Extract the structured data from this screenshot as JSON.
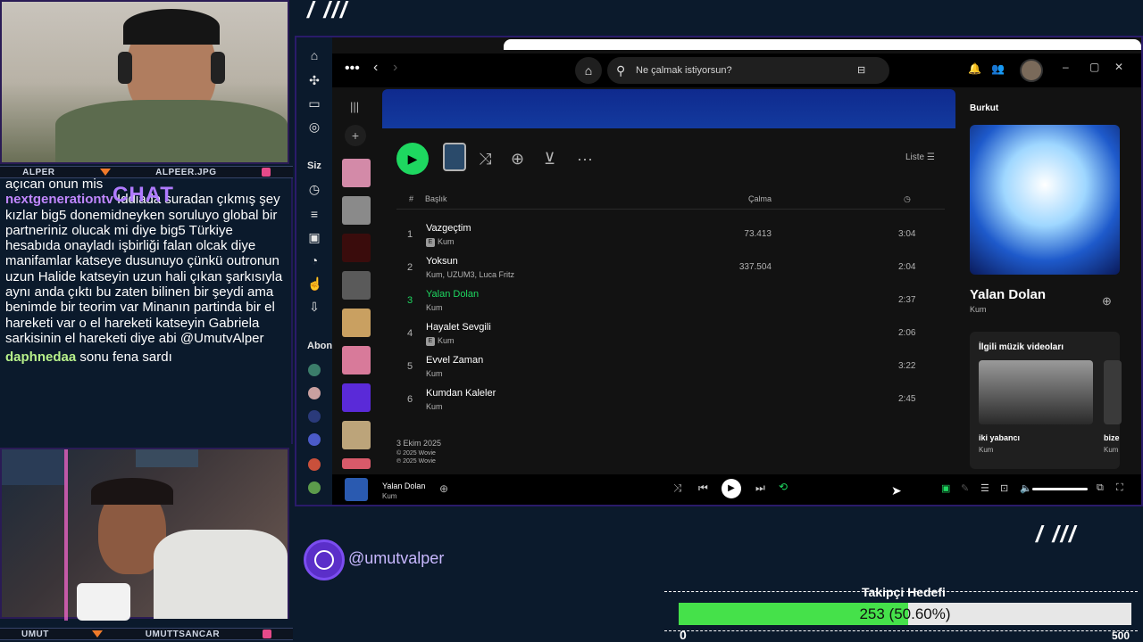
{
  "webcam_top": {
    "left_name": "ALPER",
    "right_name": "ALPEER.JPG"
  },
  "webcam_bottom": {
    "left_name": "UMUT",
    "right_name": "UMUTTSANCAR"
  },
  "chat": {
    "label": "CHAT",
    "partial_line": "açıcan onun mis",
    "messages": [
      {
        "user": "nextgenerationtv",
        "text": "Iddiada suradan çıkmış şey kızlar big5 donemidneyken soruluyo global bir partneriniz olucak mi diye big5 Türkiye hesabıda onayladı işbirliği falan olcak diye manifamlar katseye dusunuyo çünkü outronun uzun Halide katseyin uzun hali çıkan şarkısıyla aynı anda çıktı bu zaten bilinen bir şeydi ama benimde bir teorim var Minanın partinda bir el hareketi var o el hareketi katseyin Gabriela sarkisinin el hareketi diye abi @UmutvAlper"
      },
      {
        "user": "daphnedaa",
        "text": "sonu fena sardı"
      }
    ]
  },
  "spotify": {
    "search_placeholder": "Ne çalmak istiyorsun?",
    "sidebar_you": "Siz",
    "sidebar_subs": "Abon",
    "view_label": "Liste",
    "columns": {
      "hash": "#",
      "title": "Başlık",
      "plays": "Çalma"
    },
    "tracks": [
      {
        "num": "1",
        "title": "Vazgeçtim",
        "artist": "Kum",
        "explicit": "E",
        "plays": "73.413",
        "duration": "3:04",
        "active": false
      },
      {
        "num": "2",
        "title": "Yoksun",
        "artist": "Kum, UZUM3, Luca Fritz",
        "explicit": "",
        "plays": "337.504",
        "duration": "2:04",
        "active": false
      },
      {
        "num": "3",
        "title": "Yalan Dolan",
        "artist": "Kum",
        "explicit": "",
        "plays": "",
        "duration": "2:37",
        "active": true
      },
      {
        "num": "4",
        "title": "Hayalet Sevgili",
        "artist": "Kum",
        "explicit": "E",
        "plays": "",
        "duration": "2:06",
        "active": false
      },
      {
        "num": "5",
        "title": "Evvel Zaman",
        "artist": "Kum",
        "explicit": "",
        "plays": "",
        "duration": "3:22",
        "active": false
      },
      {
        "num": "6",
        "title": "Kumdan Kaleler",
        "artist": "Kum",
        "explicit": "",
        "plays": "",
        "duration": "2:45",
        "active": false
      }
    ],
    "release_date": "3 Ekim 2025",
    "copyright1": "© 2025 Wovie",
    "copyright2": "℗ 2025 Wovie",
    "right_panel": {
      "header": "Burkut",
      "song_title": "Yalan Dolan",
      "song_artist": "Kum",
      "videos_header": "İlgili müzik videoları",
      "video_title": "iki yabancı",
      "video_artist": "Kum",
      "video2_title": "bize",
      "video2_artist": "Kum"
    },
    "now_playing": {
      "title": "Yalan Dolan",
      "artist": "Kum"
    },
    "colors": {
      "accent": "#1ed760",
      "band": "#133a9e"
    }
  },
  "overlay": {
    "handle": "@umutvalper",
    "goal_title": "Takipçi Hedefi",
    "goal_text": "253 (50.60%)",
    "goal_progress": 0.506,
    "goal_min": "0",
    "goal_max": "500"
  }
}
